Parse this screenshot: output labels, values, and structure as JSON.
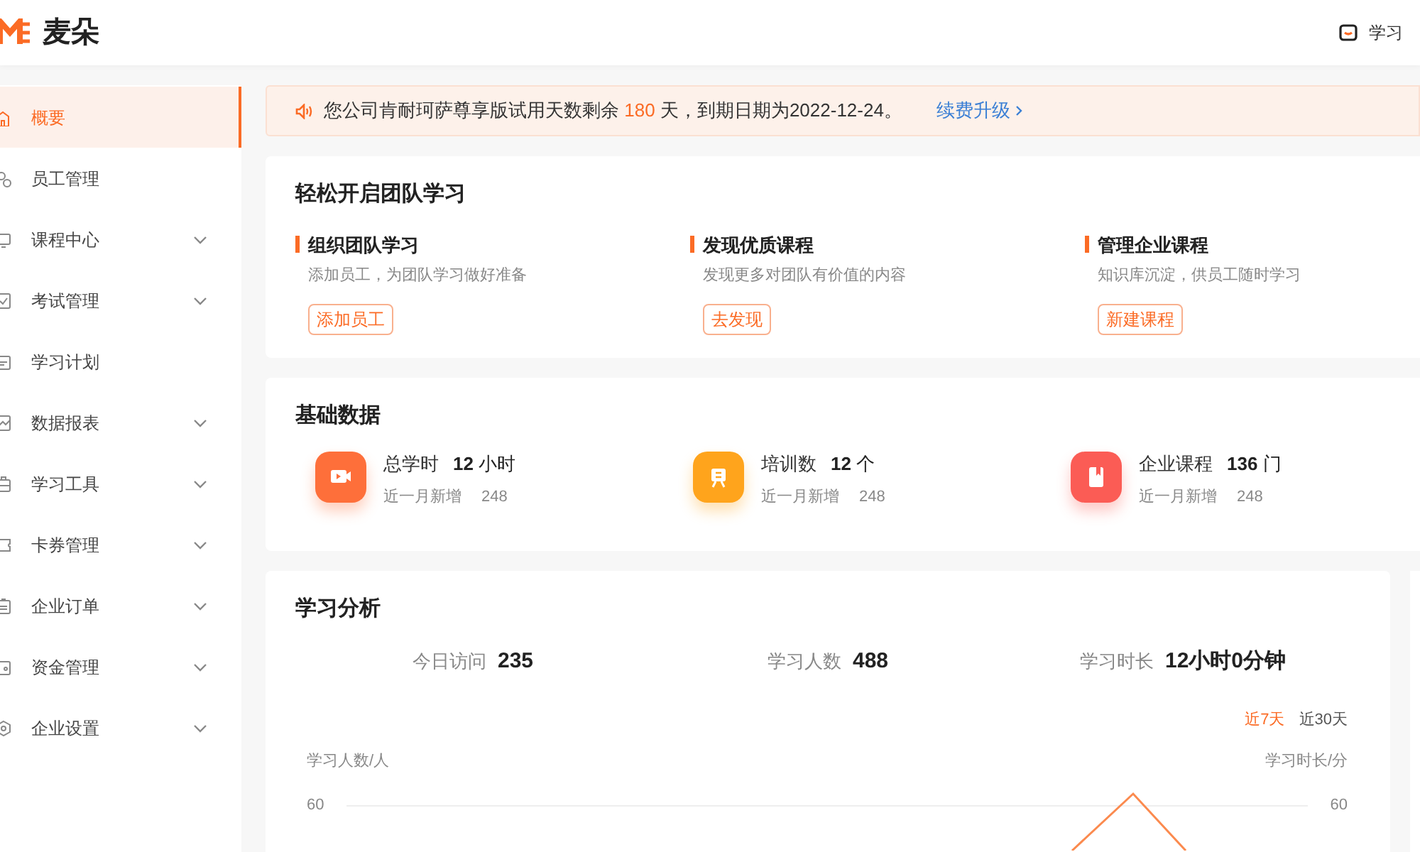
{
  "header": {
    "logo_text": "麦朵",
    "right_link": "学习"
  },
  "sidebar": {
    "items": [
      {
        "label": "概要",
        "selected": true,
        "expandable": false
      },
      {
        "label": "员工管理",
        "selected": false,
        "expandable": false
      },
      {
        "label": "课程中心",
        "selected": false,
        "expandable": true
      },
      {
        "label": "考试管理",
        "selected": false,
        "expandable": true
      },
      {
        "label": "学习计划",
        "selected": false,
        "expandable": false
      },
      {
        "label": "数据报表",
        "selected": false,
        "expandable": true
      },
      {
        "label": "学习工具",
        "selected": false,
        "expandable": true
      },
      {
        "label": "卡券管理",
        "selected": false,
        "expandable": true
      },
      {
        "label": "企业订单",
        "selected": false,
        "expandable": true
      },
      {
        "label": "资金管理",
        "selected": false,
        "expandable": true
      },
      {
        "label": "企业设置",
        "selected": false,
        "expandable": true
      }
    ]
  },
  "notice": {
    "text_before": "您公司肯耐珂萨尊享版试用天数剩余",
    "days": "180",
    "text_after": "天，到期日期为2022-12-24。",
    "link": "续费升级"
  },
  "start_card": {
    "title": "轻松开启团队学习",
    "items": [
      {
        "title": "组织团队学习",
        "desc": "添加员工，为团队学习做好准备",
        "button": "添加员工"
      },
      {
        "title": "发现优质课程",
        "desc": "发现更多对团队有价值的内容",
        "button": "去发现"
      },
      {
        "title": "管理企业课程",
        "desc": "知识库沉淀，供员工随时学习",
        "button": "新建课程"
      }
    ]
  },
  "basic_data": {
    "title": "基础数据",
    "items": [
      {
        "label": "总学时",
        "value": "12",
        "unit": "小时",
        "sub_label": "近一月新增",
        "sub_value": "248",
        "color": "#fe6f3a"
      },
      {
        "label": "培训数",
        "value": "12",
        "unit": "个",
        "sub_label": "近一月新增",
        "sub_value": "248",
        "color": "#ffa41c"
      },
      {
        "label": "企业课程",
        "value": "136",
        "unit": "门",
        "sub_label": "近一月新增",
        "sub_value": "248",
        "color": "#fb5c55"
      }
    ]
  },
  "analysis": {
    "title": "学习分析",
    "stats": [
      {
        "label": "今日访问",
        "value": "235"
      },
      {
        "label": "学习人数",
        "value": "488"
      },
      {
        "label": "学习时长",
        "value": "12小时0分钟"
      }
    ],
    "ranges": [
      {
        "label": "近7天",
        "selected": true
      },
      {
        "label": "近30天",
        "selected": false
      }
    ],
    "left_axis_label": "学习人数/人",
    "right_axis_label": "学习时长/分",
    "left_tick": "60",
    "right_tick": "60"
  }
}
